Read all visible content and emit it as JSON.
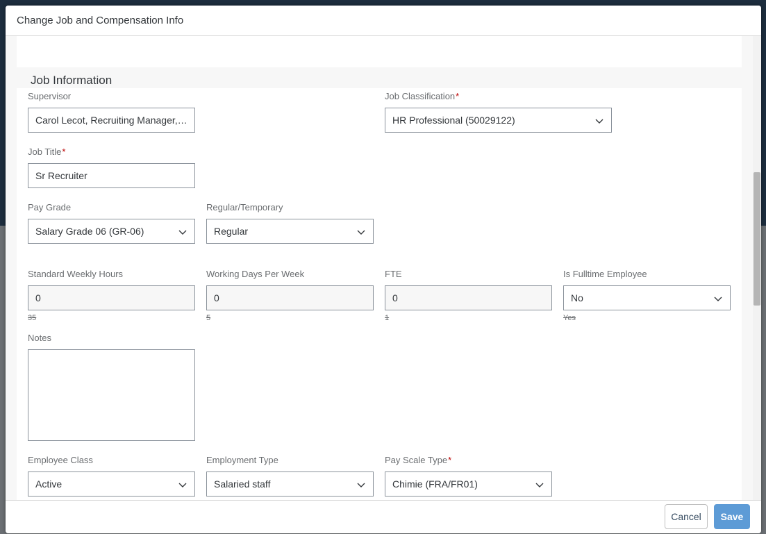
{
  "dialog": {
    "title": "Change Job and Compensation Info"
  },
  "section": {
    "title": "Job Information"
  },
  "fields": {
    "supervisor": {
      "label": "Supervisor",
      "value": "Carol Lecot, Recruiting Manager, ..."
    },
    "job_classification": {
      "label": "Job Classification",
      "required_mark": "*",
      "value": "HR Professional (50029122)"
    },
    "job_title": {
      "label": "Job Title",
      "required_mark": "*",
      "value": "Sr Recruiter"
    },
    "pay_grade": {
      "label": "Pay Grade",
      "value": "Salary Grade 06 (GR-06)"
    },
    "regular_temporary": {
      "label": "Regular/Temporary",
      "value": "Regular"
    },
    "standard_weekly_hours": {
      "label": "Standard Weekly Hours",
      "value": "0",
      "previous": "35"
    },
    "working_days_per_week": {
      "label": "Working Days Per Week",
      "value": "0",
      "previous": "5"
    },
    "fte": {
      "label": "FTE",
      "value": "0",
      "previous": "1"
    },
    "is_fulltime_employee": {
      "label": "Is Fulltime Employee",
      "value": "No",
      "previous": "Yes"
    },
    "notes": {
      "label": "Notes",
      "value": ""
    },
    "employee_class": {
      "label": "Employee Class",
      "value": "Active"
    },
    "employment_type": {
      "label": "Employment Type",
      "value": "Salaried staff"
    },
    "pay_scale_type": {
      "label": "Pay Scale Type",
      "required_mark": "*",
      "value": "Chimie (FRA/FR01)"
    }
  },
  "footer": {
    "cancel_label": "Cancel",
    "save_label": "Save"
  },
  "colors": {
    "accent": "#5d9bd6",
    "required": "#bb0000",
    "border": "#89919a"
  },
  "icons": {
    "dropdown": "chevron-down-icon"
  }
}
